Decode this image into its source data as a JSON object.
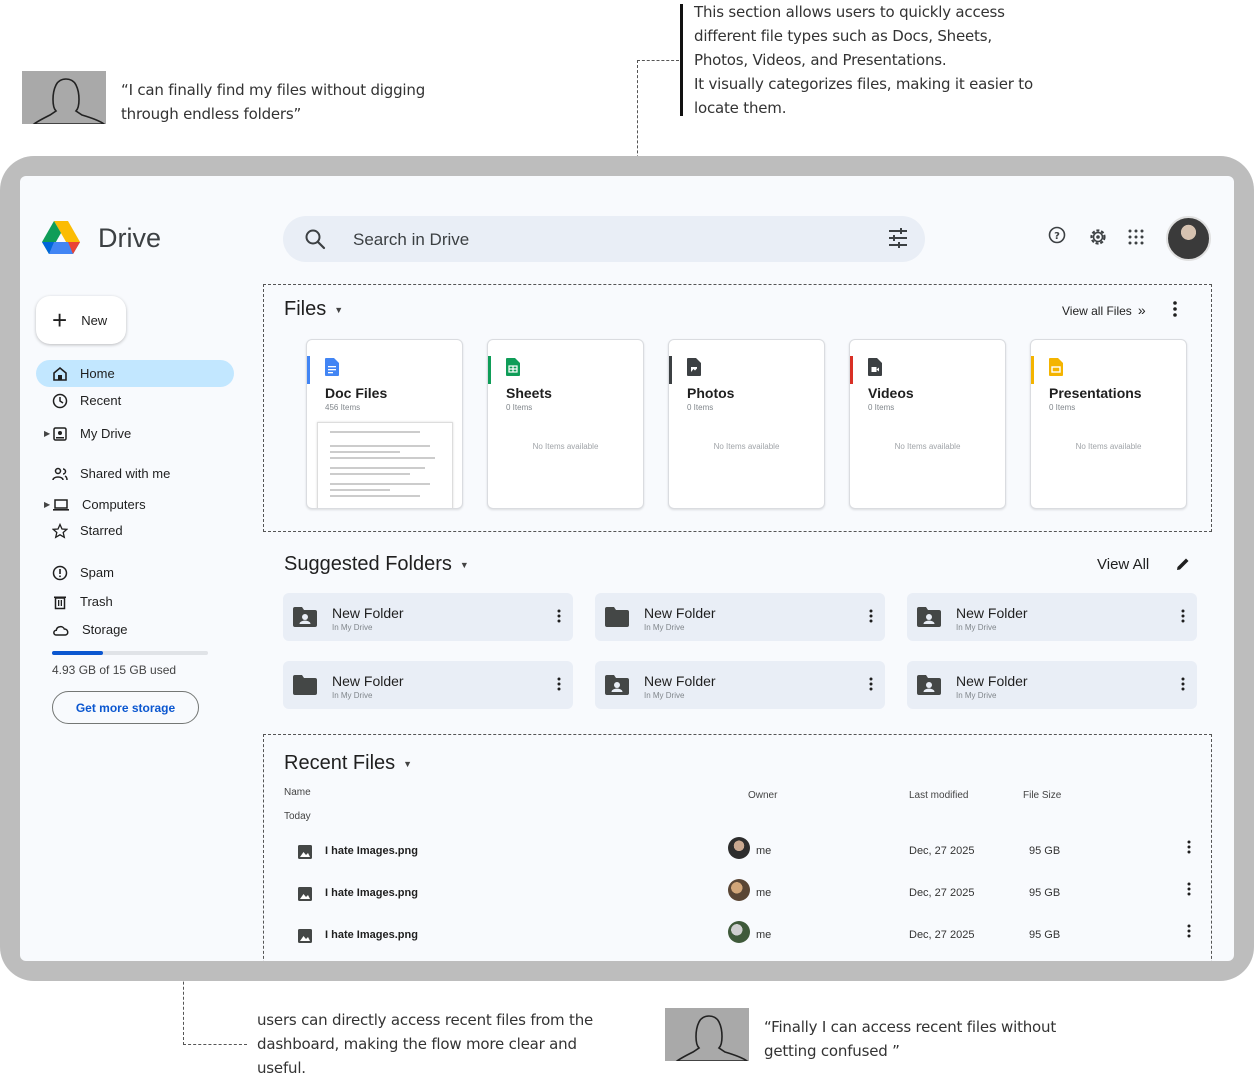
{
  "annotations": {
    "quote_top": "“I can finally find my files without digging through endless folders”",
    "files_note": "This section allows users to quickly access different file types such as Docs, Sheets, Photos, Videos, and Presentations.\nIt visually categorizes files, making it easier to locate them.",
    "recent_note": "users can directly access recent files from the dashboard, making the flow more clear and useful.",
    "quote_bottom": "“Finally I can access recent files without getting confused ”"
  },
  "app": {
    "name": "Drive"
  },
  "search": {
    "placeholder": "Search in Drive"
  },
  "sidebar": {
    "new_label": "New",
    "items": [
      {
        "label": "Home",
        "icon": "home-icon"
      },
      {
        "label": "Recent",
        "icon": "clock-icon"
      },
      {
        "label": "My Drive",
        "icon": "my-drive-icon"
      },
      {
        "label": "Shared with me",
        "icon": "people-icon"
      },
      {
        "label": "Computers",
        "icon": "computer-icon"
      },
      {
        "label": "Starred",
        "icon": "star-icon"
      },
      {
        "label": "Spam",
        "icon": "spam-icon"
      },
      {
        "label": "Trash",
        "icon": "trash-icon"
      },
      {
        "label": "Storage",
        "icon": "cloud-icon"
      }
    ],
    "storage_used_fraction": 0.33,
    "storage_text": "4.93 GB of 15 GB used",
    "get_storage_label": "Get more storage"
  },
  "files": {
    "title": "Files",
    "view_all": "View all Files",
    "empty_text": "No Items available",
    "cards": [
      {
        "name": "Doc Files",
        "count": "456 Items",
        "color": "#4285f4",
        "icon": "docs-icon"
      },
      {
        "name": "Sheets",
        "count": "0 Items",
        "color": "#0f9d58",
        "icon": "sheets-icon"
      },
      {
        "name": "Photos",
        "count": "0 Items",
        "color": "#3c4043",
        "icon": "photo-file-icon"
      },
      {
        "name": "Videos",
        "count": "0 Items",
        "color": "#d93025",
        "icon": "video-file-icon"
      },
      {
        "name": "Presentations",
        "count": "0 Items",
        "color": "#f4b400",
        "icon": "slides-icon"
      }
    ]
  },
  "suggested": {
    "title": "Suggested Folders",
    "view_all": "View All",
    "folders": [
      {
        "name": "New Folder",
        "location": "In My Drive",
        "icon": "shared-folder-icon"
      },
      {
        "name": "New Folder",
        "location": "In My Drive",
        "icon": "folder-icon"
      },
      {
        "name": "New Folder",
        "location": "In My Drive",
        "icon": "shared-folder-icon"
      },
      {
        "name": "New Folder",
        "location": "In My Drive",
        "icon": "folder-icon"
      },
      {
        "name": "New Folder",
        "location": "In My Drive",
        "icon": "shared-folder-icon"
      },
      {
        "name": "New Folder",
        "location": "In My Drive",
        "icon": "shared-folder-icon"
      }
    ]
  },
  "recent": {
    "title": "Recent Files",
    "columns": {
      "name": "Name",
      "owner": "Owner",
      "modified": "Last modified",
      "size": "File Size"
    },
    "group": "Today",
    "rows": [
      {
        "name": "I hate Images.png",
        "owner": "me",
        "modified": "Dec, 27 2025",
        "size": "95 GB"
      },
      {
        "name": "I hate Images.png",
        "owner": "me",
        "modified": "Dec, 27 2025",
        "size": "95 GB"
      },
      {
        "name": "I hate Images.png",
        "owner": "me",
        "modified": "Dec, 27 2025",
        "size": "95 GB"
      }
    ]
  }
}
